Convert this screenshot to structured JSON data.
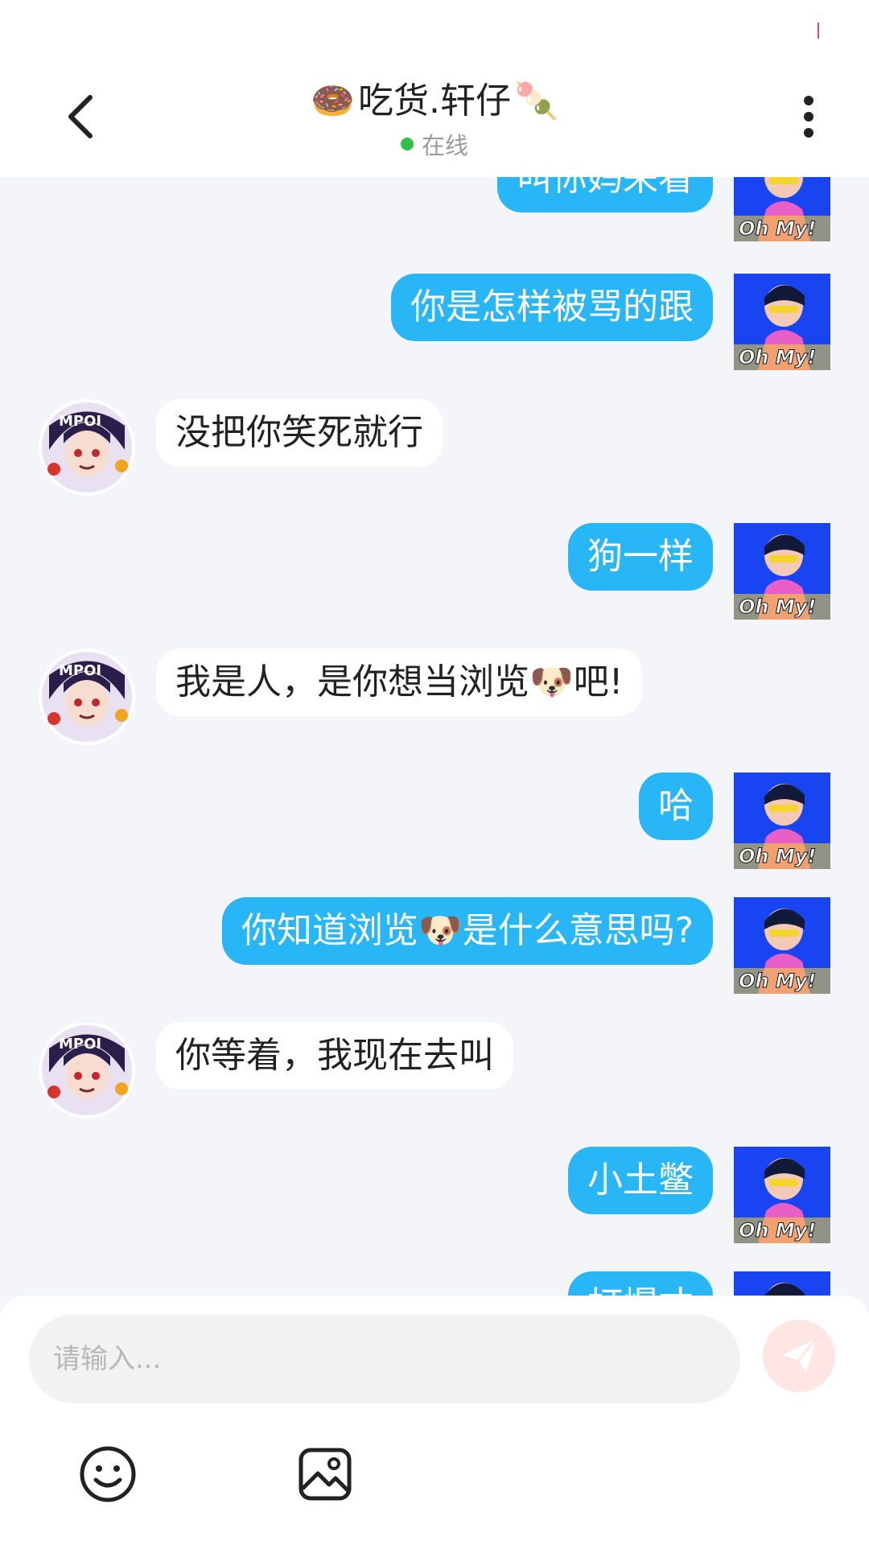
{
  "header": {
    "title": "吃货.轩仔",
    "title_prefix_emoji": "🍩",
    "title_suffix_emoji": "🍡",
    "status_text": "在线",
    "back_icon": "chevron-left-icon",
    "more_icon": "more-vertical-icon"
  },
  "messages": [
    {
      "side": "me",
      "text": "叫你妈来看"
    },
    {
      "side": "me",
      "text": "你是怎样被骂的跟"
    },
    {
      "side": "them",
      "text": "没把你笑死就行"
    },
    {
      "side": "me",
      "text": "狗一样"
    },
    {
      "side": "them",
      "text": "我是人，是你想当浏览🐶吧!"
    },
    {
      "side": "me",
      "text": "哈"
    },
    {
      "side": "me",
      "text": "你知道浏览🐶是什么意思吗?"
    },
    {
      "side": "them",
      "text": "你等着，我现在去叫"
    },
    {
      "side": "me",
      "text": "小土鳖"
    },
    {
      "side": "me",
      "text": "打爆才"
    }
  ],
  "my_avatar_text": "Oh My!",
  "their_avatar_text": "MPOI",
  "input": {
    "placeholder": "请输入...",
    "value": ""
  },
  "toolbar": {
    "emoji_icon": "smiley-icon",
    "image_icon": "image-icon",
    "send_icon": "send-icon"
  },
  "colors": {
    "my_bubble": "#29b6f6",
    "their_bubble": "#ffffff",
    "chat_background": "#f3f5f8",
    "online_dot": "#2ec24a",
    "send_button": "#ffe6e2",
    "send_icon": "#ffffff"
  }
}
